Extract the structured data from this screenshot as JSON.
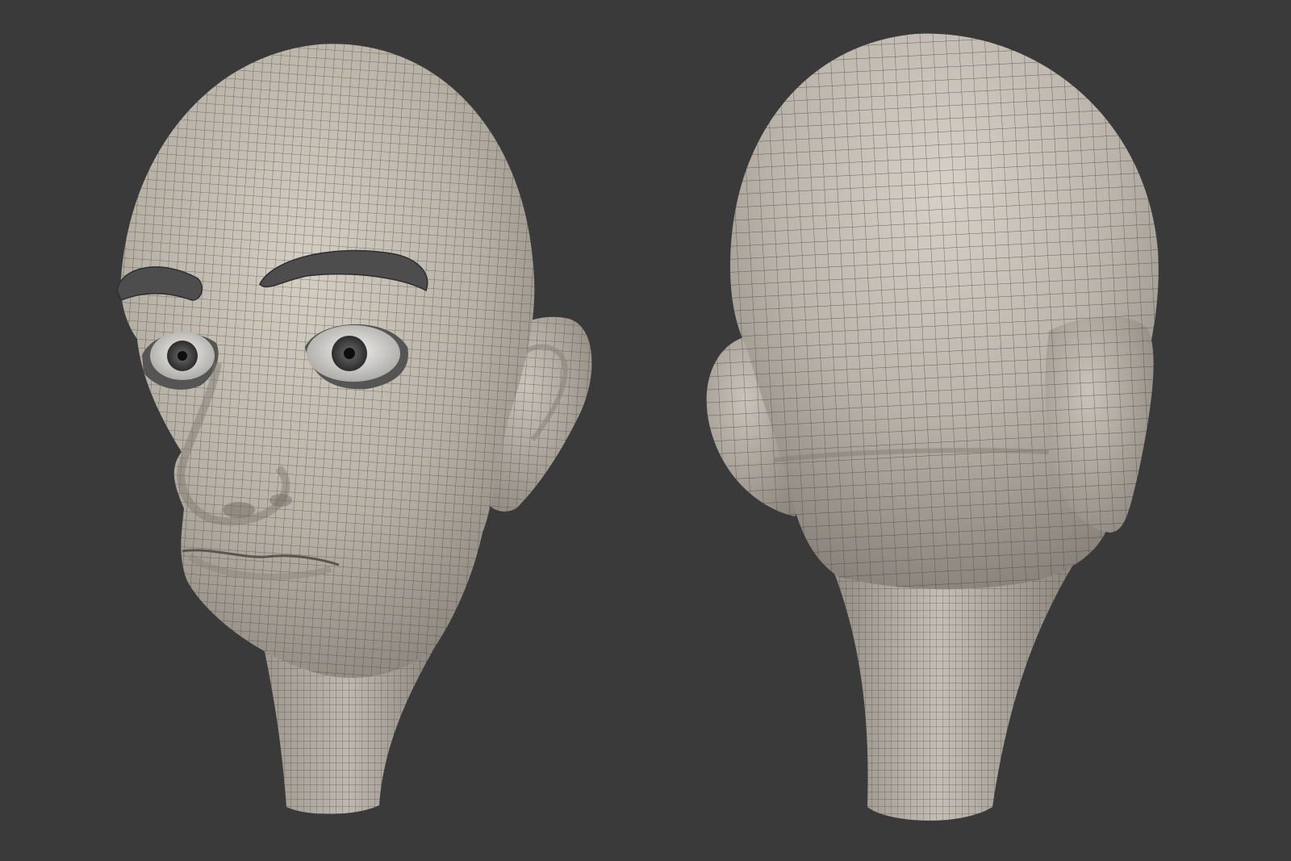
{
  "scene": {
    "background_color": "#3a3a3a",
    "mesh_color": "#b3ada3",
    "wire_color": "#3b3b3b",
    "views": [
      {
        "name": "front-three-quarter",
        "shows": [
          "eyebrows",
          "eyes",
          "nose",
          "mouth",
          "ear",
          "neck"
        ]
      },
      {
        "name": "back-three-quarter",
        "shows": [
          "skull",
          "ears",
          "neck"
        ]
      }
    ]
  }
}
